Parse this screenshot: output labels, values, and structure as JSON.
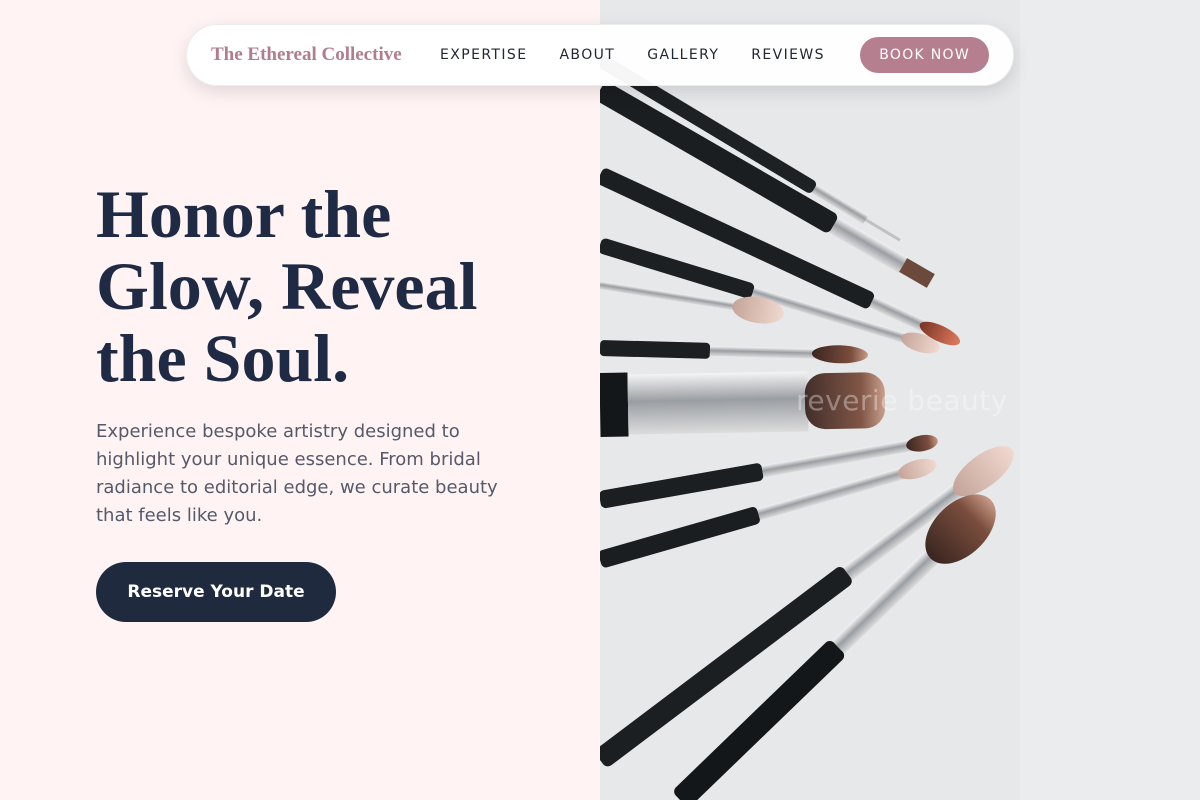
{
  "nav": {
    "brand": "The Ethereal Collective",
    "links": [
      {
        "label": "EXPERTISE"
      },
      {
        "label": "ABOUT"
      },
      {
        "label": "GALLERY"
      },
      {
        "label": "REVIEWS"
      }
    ],
    "cta": "BOOK NOW"
  },
  "hero": {
    "headline": "Honor the Glow, Reveal the Soul.",
    "subcopy": "Experience bespoke artistry designed to highlight your unique essence. From bridal radiance to editorial edge, we curate beauty that feels like you.",
    "cta": "Reserve Your Date"
  },
  "image": {
    "watermark": "reverie beauty"
  },
  "colors": {
    "background": "#fff4f3",
    "brand": "#b07d8d",
    "accent_button": "#b67f90",
    "primary_dark": "#1f2a3f",
    "text_body": "#55596a"
  }
}
